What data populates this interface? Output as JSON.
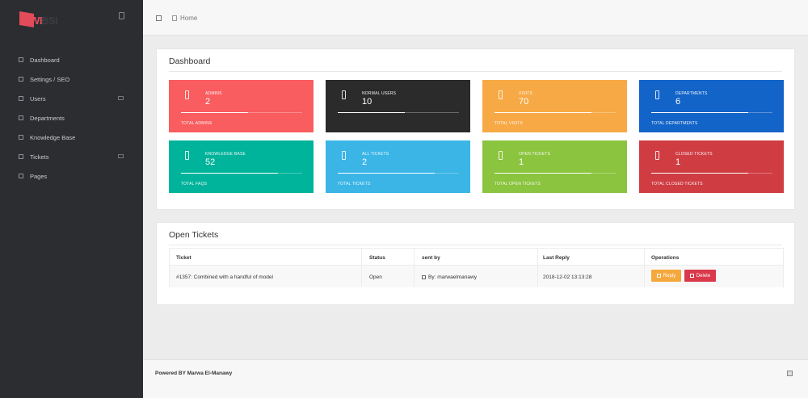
{
  "sidebar": {
    "logo_text_a": "WE",
    "logo_text_b": "BSI",
    "items": [
      {
        "label": "Dashboard"
      },
      {
        "label": "Settings / SEO"
      },
      {
        "label": "Users"
      },
      {
        "label": "Departments"
      },
      {
        "label": "Knowledge Base"
      },
      {
        "label": "Tickets"
      },
      {
        "label": "Pages"
      }
    ]
  },
  "topbar": {
    "breadcrumb": "Home"
  },
  "dashboard": {
    "title": "Dashboard",
    "cards": [
      {
        "title": "ADMINS",
        "value": "2",
        "footer": "TOTAL ADMINS",
        "color": "#f95d5f",
        "progress": 0.55
      },
      {
        "title": "NORMAL USERS",
        "value": "10",
        "footer": "",
        "color": "#2b2b2b",
        "progress": 0.55
      },
      {
        "title": "VISITS",
        "value": "70",
        "footer": "TOTAL VISITS",
        "color": "#f7a945",
        "progress": 0.8
      },
      {
        "title": "DEPARTMENTS",
        "value": "6",
        "footer": "TOTAL DEPARTMENTS",
        "color": "#1364c8",
        "progress": 0.8
      },
      {
        "title": "KNOWLEDGE BASE",
        "value": "52",
        "footer": "TOTAL FAQS",
        "color": "#00b39b",
        "progress": 0.8
      },
      {
        "title": "ALL TICKETS",
        "value": "2",
        "footer": "TOTAL TICKETS",
        "color": "#3ab5e6",
        "progress": 0.8
      },
      {
        "title": "OPEN TICKETS",
        "value": "1",
        "footer": "TOTAL OPEN TICKETS",
        "color": "#8bc43f",
        "progress": 0.8
      },
      {
        "title": "CLOSED TICKETS",
        "value": "1",
        "footer": "TOTAL CLOSED TICKETS",
        "color": "#cf3d43",
        "progress": 0.8
      }
    ]
  },
  "tickets": {
    "title": "Open Tickets",
    "headers": [
      "Ticket",
      "Status",
      "sent by",
      "Last Reply",
      "Operations"
    ],
    "rows": [
      {
        "ticket": "#1357: Combined with a handful of model",
        "status": "Open",
        "sent_by": "By: marwaelmanawy",
        "last_reply": "2018-12-02 13:13:28"
      }
    ],
    "reply_label": "Reply",
    "delete_label": "Delete"
  },
  "footer": {
    "text": "Powered BY Marwa El-Manawy"
  }
}
